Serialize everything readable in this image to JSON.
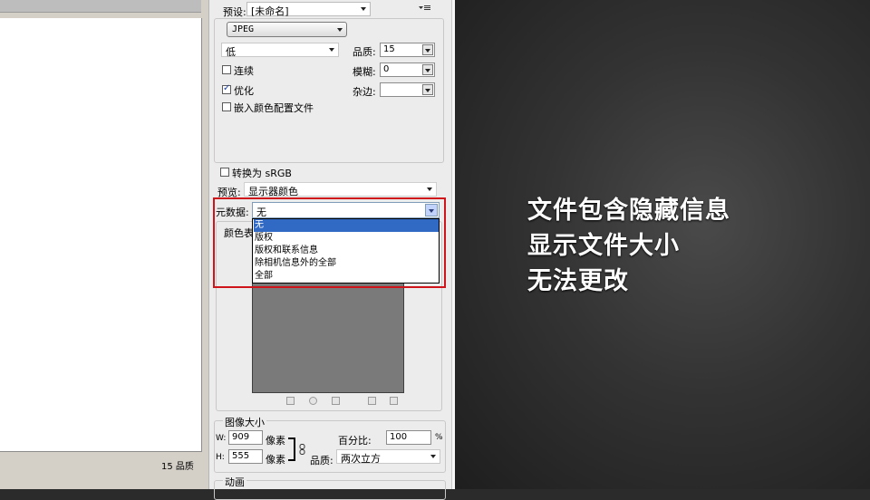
{
  "left": {
    "status": "15 品质"
  },
  "panel": {
    "preset_label": "预设:",
    "preset_value": "[未命名]",
    "menu_icon": "panel-menu-icon",
    "format_value": "JPEG",
    "quality_preset": "低",
    "quality_label": "品质:",
    "quality_value": "15",
    "progressive_label": "连续",
    "progressive_checked": false,
    "blur_label": "模糊:",
    "blur_value": "0",
    "optimized_label": "优化",
    "optimized_checked": true,
    "matte_label": "杂边:",
    "matte_value": "",
    "embed_profile_label": "嵌入颜色配置文件",
    "embed_profile_checked": false,
    "convert_srgb_label": "转换为 sRGB",
    "convert_srgb_checked": false,
    "preview_label": "预览:",
    "preview_value": "显示器颜色",
    "metadata_label": "元数据:",
    "metadata_value": "无",
    "metadata_options": [
      "无",
      "版权",
      "版权和联系信息",
      "除相机信息外的全部",
      "全部"
    ],
    "color_table_label": "颜色表",
    "image_size_title": "图像大小",
    "width_label": "W:",
    "width_value": "909",
    "height_label": "H:",
    "height_value": "555",
    "unit_px": "像素",
    "percent_label": "百分比:",
    "percent_value": "100",
    "percent_unit": "%",
    "resample_label": "品质:",
    "resample_value": "两次立方",
    "animation_title": "动画"
  },
  "overlay": {
    "lines": [
      "文件包含隐藏信息",
      "显示文件大小",
      "无法更改"
    ]
  },
  "colors": {
    "highlight_red": "#d0141c",
    "selection_blue": "#316ac5"
  }
}
